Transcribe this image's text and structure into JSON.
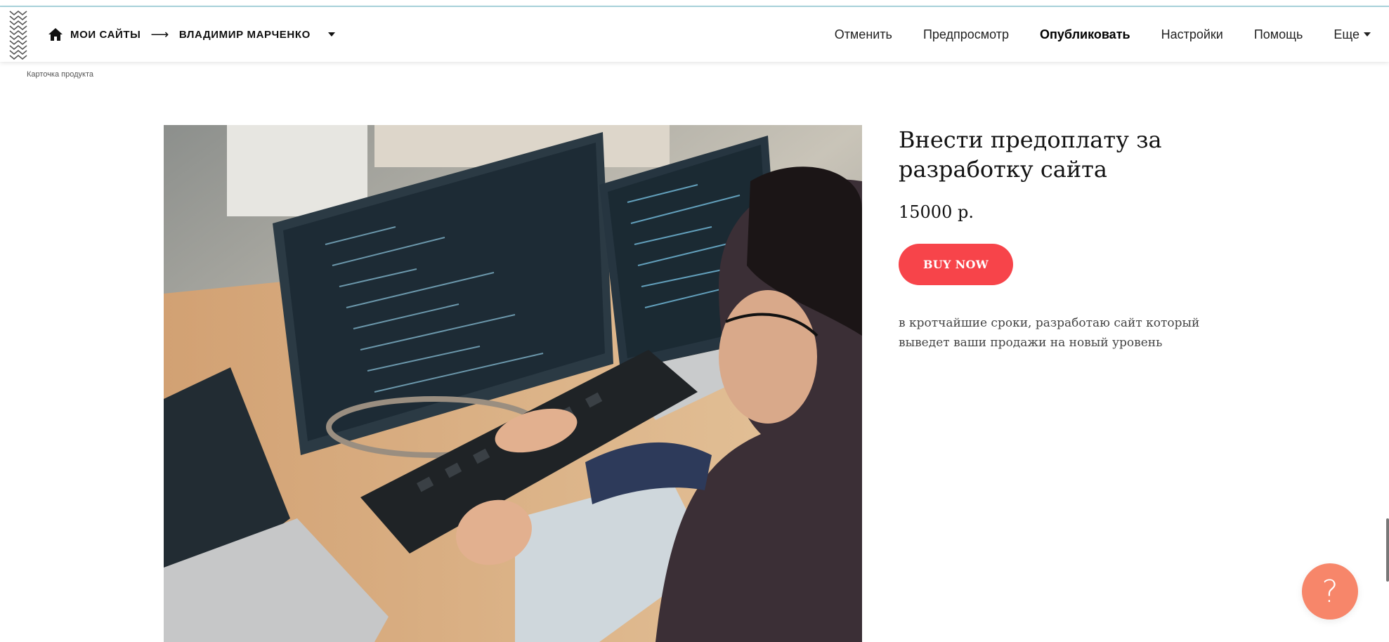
{
  "topbar": {
    "logo": "zigzag-logo",
    "home_icon": "home-icon",
    "breadcrumb_root": "МОИ САЙТЫ",
    "breadcrumb_arrow": "⟶",
    "breadcrumb_site": "ВЛАДИМИР МАРЧЕНКО",
    "nav": {
      "cancel": "Отменить",
      "preview": "Предпросмотр",
      "publish": "Опубликовать",
      "settings": "Настройки",
      "help": "Помощь",
      "more": "Еще"
    }
  },
  "block_label": "Карточка продукта",
  "product": {
    "title": "Внести предоплату за разработку сайта",
    "price": "15000 р.",
    "button": "BUY NOW",
    "description": "в кротчайшие сроки, разработаю сайт который выведет ваши продажи на новый уровень",
    "image": "photo of a programmer typing at a desk with monitors and laptops showing code"
  },
  "help_button": "?",
  "colors": {
    "buy_button": "#f7444a",
    "help_button": "#f7866a",
    "top_accent": "#a9d4dd"
  }
}
